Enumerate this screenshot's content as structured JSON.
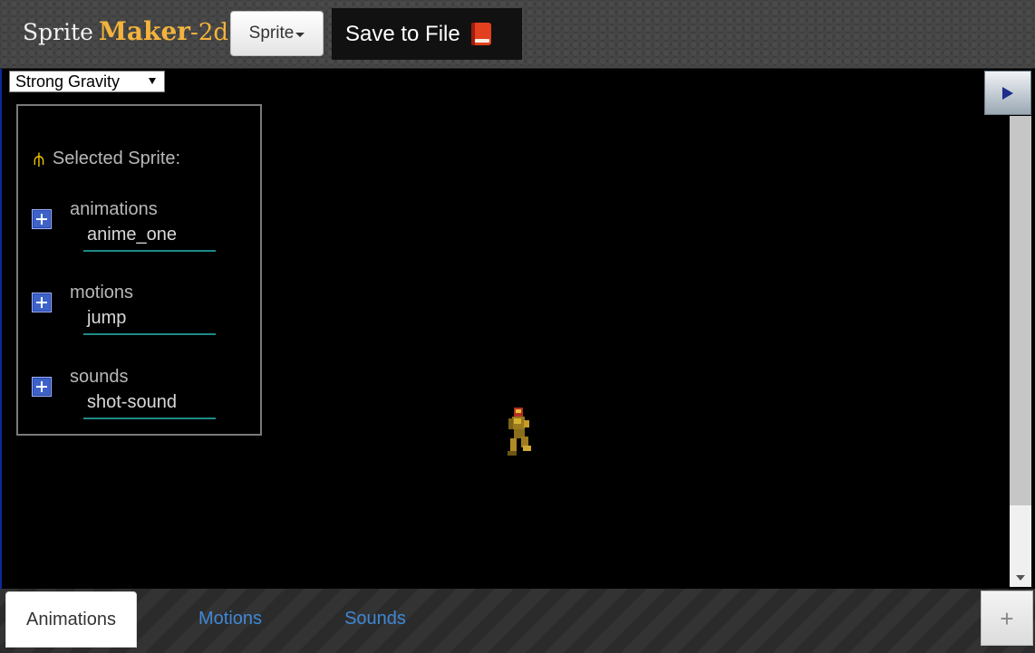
{
  "header": {
    "brand": {
      "part1": "Sprite",
      "part2": "Maker",
      "part3": "-2d"
    },
    "sprite_menu_label": "Sprite",
    "save_label": "Save to File"
  },
  "toolbar": {
    "gravity_selected": "Strong Gravity"
  },
  "panel": {
    "title": "Selected Sprite:",
    "sections": [
      {
        "label": "animations",
        "value": "anime_one"
      },
      {
        "label": "motions",
        "value": "jump"
      },
      {
        "label": "sounds",
        "value": "shot-sound"
      }
    ]
  },
  "tabs": {
    "items": [
      {
        "label": "Animations",
        "active": true
      },
      {
        "label": "Motions",
        "active": false
      },
      {
        "label": "Sounds",
        "active": false
      }
    ],
    "add_label": "+"
  },
  "colors": {
    "brand_accent": "#f4b33c",
    "tab_link": "#3f88d6",
    "input_underline": "#1e8b88",
    "trident_icon": "#f1c400"
  },
  "icons": {
    "panel_header": "trident-icon",
    "expand": "plus-icon",
    "save": "book-icon",
    "run": "play-icon"
  }
}
